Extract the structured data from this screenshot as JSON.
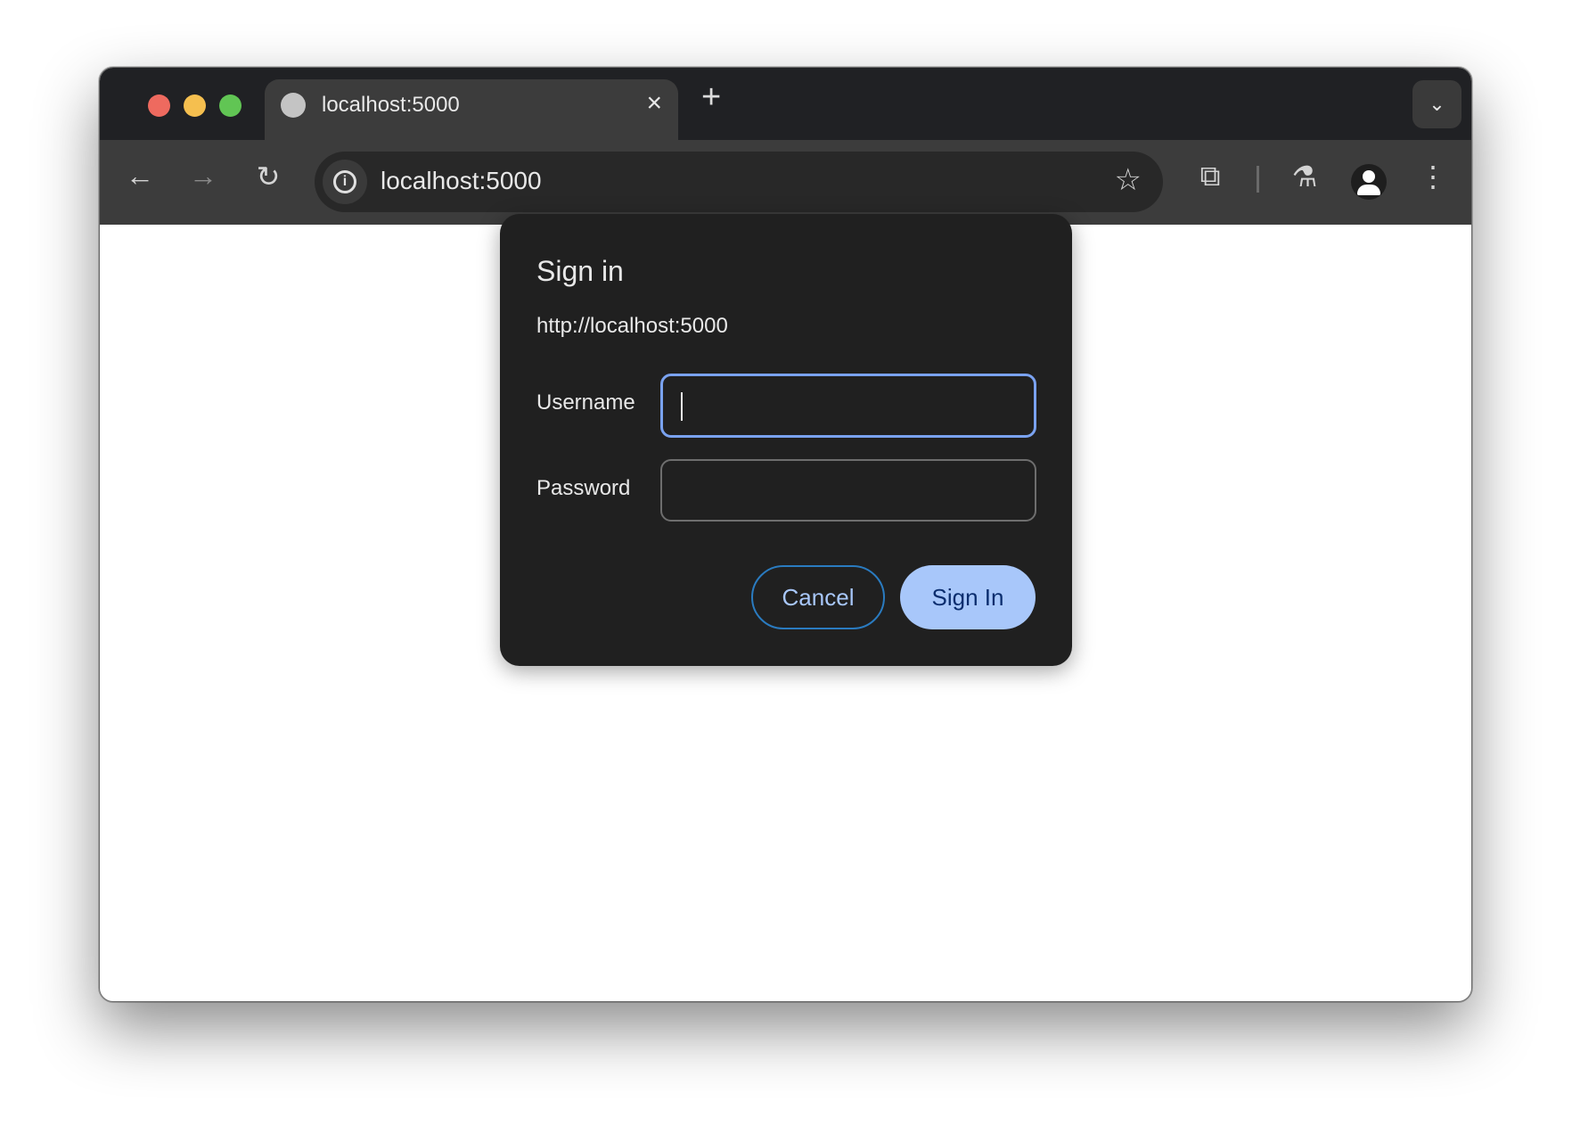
{
  "browser": {
    "tab": {
      "title": "localhost:5000",
      "icon": "globe-icon",
      "close": "×"
    },
    "new_tab": "+",
    "tab_menu": "⌄",
    "address": "localhost:5000",
    "icons": {
      "back": "←",
      "forward": "→",
      "reload": "↻",
      "star": "☆",
      "extensions": "⧉",
      "labs": "⚗",
      "menu": "⋮"
    }
  },
  "dialog": {
    "title": "Sign in",
    "origin": "http://localhost:5000",
    "username_label": "Username",
    "username_value": "",
    "password_label": "Password",
    "password_value": "",
    "cancel_label": "Cancel",
    "signin_label": "Sign In"
  },
  "colors": {
    "accent": "#a8c7fa",
    "focus": "#7aa2f0",
    "dialog_bg": "#202020"
  }
}
